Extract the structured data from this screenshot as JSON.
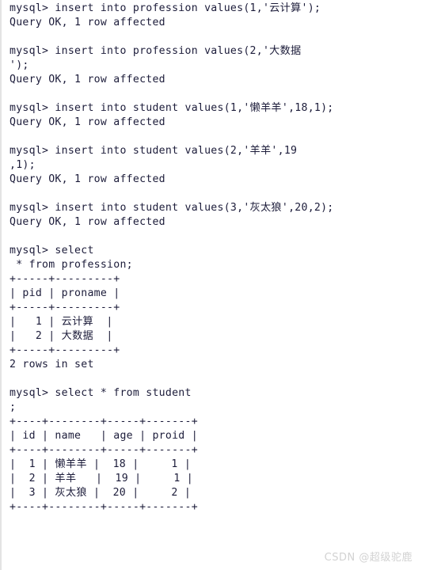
{
  "terminal": {
    "prompt": "mysql>",
    "text_color": "#1c1c3a",
    "background_color": "#ffffff",
    "left_border_color": "#e3e3e3",
    "lines": [
      "mysql> insert into profession values(1,'云计算');",
      "Query OK, 1 row affected",
      "",
      "mysql> insert into profession values(2,'大数据",
      "');",
      "Query OK, 1 row affected",
      "",
      "mysql> insert into student values(1,'懒羊羊',18,1);",
      "Query OK, 1 row affected",
      "",
      "mysql> insert into student values(2,'羊羊',19",
      ",1);",
      "Query OK, 1 row affected",
      "",
      "mysql> insert into student values(3,'灰太狼',20,2);",
      "Query OK, 1 row affected",
      "",
      "mysql> select",
      " * from profession;",
      "+-----+---------+",
      "| pid | proname |",
      "+-----+---------+",
      "|   1 | 云计算  |",
      "|   2 | 大数据  |",
      "+-----+---------+",
      "2 rows in set",
      "",
      "mysql> select * from student",
      ";",
      "+----+--------+-----+-------+",
      "| id | name   | age | proid |",
      "+----+--------+-----+-------+",
      "|  1 | 懒羊羊 |  18 |     1 |",
      "|  2 | 羊羊   |  19 |     1 |",
      "|  3 | 灰太狼 |  20 |     2 |",
      "+----+--------+-----+-------+"
    ]
  },
  "statements": [
    {
      "command": "insert into profession values(1,'云计算');",
      "result": "Query OK, 1 row affected"
    },
    {
      "command": "insert into profession values(2,'大数据');",
      "result": "Query OK, 1 row affected"
    },
    {
      "command": "insert into student values(1,'懒羊羊',18,1);",
      "result": "Query OK, 1 row affected"
    },
    {
      "command": "insert into student values(2,'羊羊',19,1);",
      "result": "Query OK, 1 row affected"
    },
    {
      "command": "insert into student values(3,'灰太狼',20,2);",
      "result": "Query OK, 1 row affected"
    },
    {
      "command": "select * from profession;",
      "result": "2 rows in set"
    },
    {
      "command": "select * from student;",
      "result": ""
    }
  ],
  "result_tables": [
    {
      "name": "profession",
      "columns": [
        "pid",
        "proname"
      ],
      "rows": [
        [
          "1",
          "云计算"
        ],
        [
          "2",
          "大数据"
        ]
      ],
      "footer": "2 rows in set"
    },
    {
      "name": "student",
      "columns": [
        "id",
        "name",
        "age",
        "proid"
      ],
      "rows": [
        [
          "1",
          "懒羊羊",
          "18",
          "1"
        ],
        [
          "2",
          "羊羊",
          "19",
          "1"
        ],
        [
          "3",
          "灰太狼",
          "20",
          "2"
        ]
      ],
      "footer": ""
    }
  ],
  "watermark": {
    "text": "CSDN @超级驼鹿",
    "color": "#d2d2d2"
  }
}
